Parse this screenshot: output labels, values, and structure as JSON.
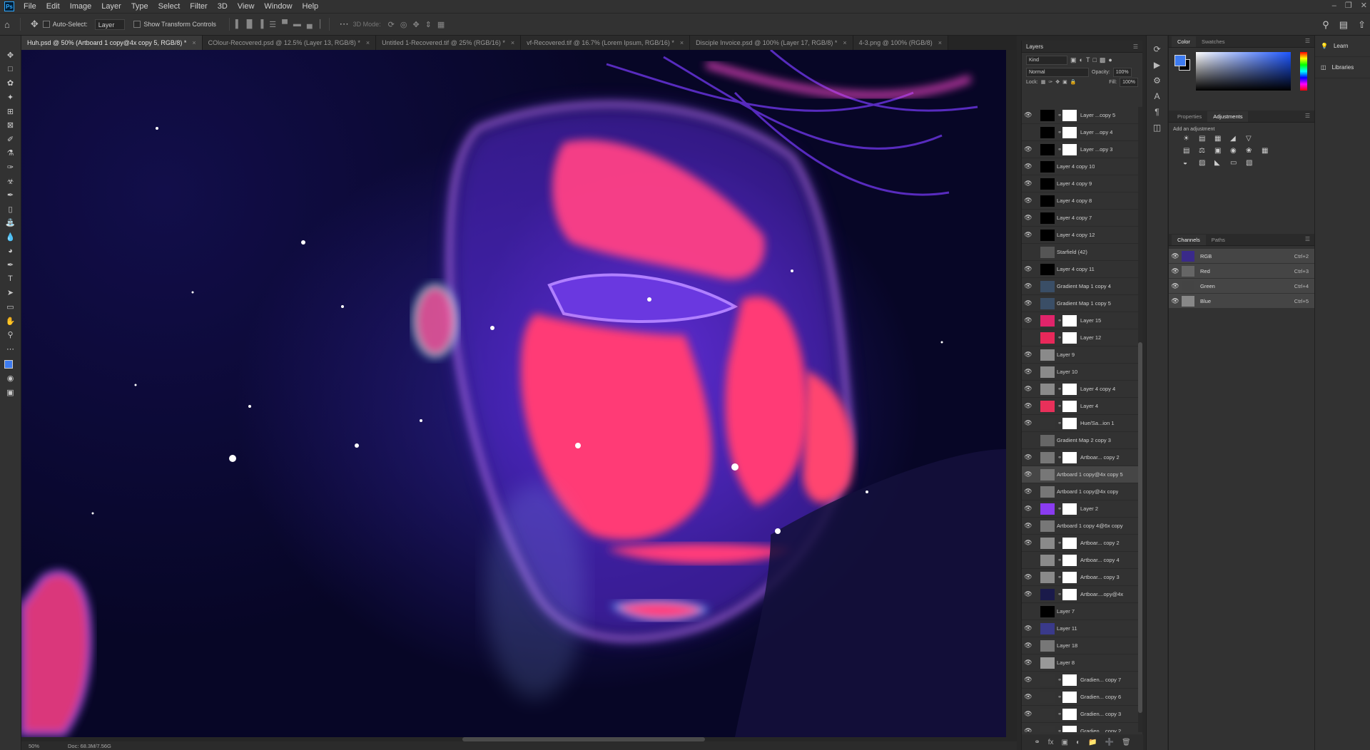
{
  "app": {
    "logo": "Ps"
  },
  "menu": [
    "File",
    "Edit",
    "Image",
    "Layer",
    "Type",
    "Select",
    "Filter",
    "3D",
    "View",
    "Window",
    "Help"
  ],
  "options_bar": {
    "auto_select_label": "Auto-Select:",
    "auto_select_value": "Layer",
    "show_transform_label": "Show Transform Controls",
    "mode_3d_label": "3D Mode:"
  },
  "doc_tabs": [
    "Huh.psd @ 50% (Artboard 1 copy@4x copy 5, RGB/8) *",
    "COlour-Recovered.psd @ 12.5% (Layer 13, RGB/8) *",
    "Untitled 1-Recovered.tif @ 25% (RGB/16) *",
    "vf-Recovered.tif @ 16.7% (Lorem Ipsum, RGB/16) *",
    "Disciple Invoice.psd @ 100% (Layer 17, RGB/8) *",
    "4-3.png @ 100% (RGB/8)"
  ],
  "status": {
    "zoom": "50%",
    "doc": "Doc: 68.3M/7.56G"
  },
  "layers_panel": {
    "title": "Layers",
    "kind": "Kind",
    "blend_mode": "Normal",
    "opacity_label": "Opacity:",
    "opacity_value": "100%",
    "lock_label": "Lock:",
    "fill_label": "Fill:",
    "fill_value": "100%",
    "layers": [
      {
        "name": "Layer ...copy 5",
        "visible": true,
        "thumb": "#000",
        "mask": true
      },
      {
        "name": "Layer ...opy 4",
        "visible": false,
        "thumb": "#000",
        "mask": true
      },
      {
        "name": "Layer ...opy 3",
        "visible": true,
        "thumb": "#000",
        "mask": true
      },
      {
        "name": "Layer 4 copy 10",
        "visible": true,
        "thumb": "#000",
        "mask": false
      },
      {
        "name": "Layer 4 copy 9",
        "visible": true,
        "thumb": "#000",
        "mask": false
      },
      {
        "name": "Layer 4 copy 8",
        "visible": true,
        "thumb": "#000",
        "mask": false
      },
      {
        "name": "Layer 4 copy 7",
        "visible": true,
        "thumb": "#000",
        "mask": false
      },
      {
        "name": "Layer 4 copy 12",
        "visible": true,
        "thumb": "#000",
        "mask": false
      },
      {
        "name": "Starfield (42)",
        "visible": false,
        "thumb": "#555",
        "mask": false
      },
      {
        "name": "Layer 4 copy 11",
        "visible": true,
        "thumb": "#000",
        "mask": false
      },
      {
        "name": "Gradient Map 1 copy 4",
        "visible": true,
        "thumb": "#3a4e66",
        "mask": false
      },
      {
        "name": "Gradient Map 1 copy 5",
        "visible": true,
        "thumb": "#3a4e66",
        "mask": false
      },
      {
        "name": "Layer 15",
        "visible": true,
        "thumb": "#e0246a",
        "mask": true
      },
      {
        "name": "Layer 12",
        "visible": false,
        "thumb": "#e8285a",
        "mask": true
      },
      {
        "name": "Layer 9",
        "visible": true,
        "thumb": "#8a8a8a",
        "mask": false
      },
      {
        "name": "Layer 10",
        "visible": true,
        "thumb": "#8a8a8a",
        "mask": false
      },
      {
        "name": "Layer 4 copy 4",
        "visible": true,
        "thumb": "#8a8a8a",
        "mask": true
      },
      {
        "name": "Layer 4",
        "visible": true,
        "thumb": "#e8305a",
        "mask": true
      },
      {
        "name": "Hue/Sa...ion 1",
        "visible": true,
        "thumb": "#333",
        "mask": true
      },
      {
        "name": "Gradient Map 2 copy 3",
        "visible": false,
        "thumb": "#666",
        "mask": false
      },
      {
        "name": "Artboar... copy 2",
        "visible": true,
        "thumb": "#777",
        "mask": true
      },
      {
        "name": "Artboard 1 copy@4x copy 5",
        "visible": true,
        "thumb": "#777",
        "mask": false,
        "selected": true
      },
      {
        "name": "Artboard 1 copy@4x copy",
        "visible": true,
        "thumb": "#777",
        "mask": false
      },
      {
        "name": "Layer 2",
        "visible": true,
        "thumb": "#8a3cf0",
        "mask": true
      },
      {
        "name": "Artboard 1 copy 4@6x copy",
        "visible": true,
        "thumb": "#777",
        "mask": false
      },
      {
        "name": "Artboar... copy 2",
        "visible": true,
        "thumb": "#8a8a8a",
        "mask": true
      },
      {
        "name": "Artboar... copy 4",
        "visible": false,
        "thumb": "#8a8a8a",
        "mask": true
      },
      {
        "name": "Artboar... copy 3",
        "visible": true,
        "thumb": "#8a8a8a",
        "mask": true
      },
      {
        "name": "Artboar....opy@4x",
        "visible": true,
        "thumb": "#1a1a4a",
        "mask": true
      },
      {
        "name": "Layer 7",
        "visible": false,
        "thumb": "#000",
        "mask": false
      },
      {
        "name": "Layer 11",
        "visible": true,
        "thumb": "#3a3a8a",
        "mask": false
      },
      {
        "name": "Layer 18",
        "visible": true,
        "thumb": "#777",
        "mask": false
      },
      {
        "name": "Layer 8",
        "visible": true,
        "thumb": "#999",
        "mask": false
      },
      {
        "name": "Gradien... copy 7",
        "visible": true,
        "thumb": "#333",
        "mask": true
      },
      {
        "name": "Gradien... copy 6",
        "visible": true,
        "thumb": "#333",
        "mask": true
      },
      {
        "name": "Gradien... copy 3",
        "visible": true,
        "thumb": "#333",
        "mask": true
      },
      {
        "name": "Gradien... copy 2",
        "visible": true,
        "thumb": "#333",
        "mask": true
      }
    ]
  },
  "color_panel": {
    "tabs": [
      "Color",
      "Swatches"
    ],
    "foreground": "#3d7bf0"
  },
  "adjustments_panel": {
    "tabs": [
      "Properties",
      "Adjustments"
    ],
    "hint": "Add an adjustment"
  },
  "channels_panel": {
    "tabs": [
      "Channels",
      "Paths"
    ],
    "channels": [
      {
        "name": "RGB",
        "key": "Ctrl+2"
      },
      {
        "name": "Red",
        "key": "Ctrl+3"
      },
      {
        "name": "Green",
        "key": "Ctrl+4"
      },
      {
        "name": "Blue",
        "key": "Ctrl+5"
      }
    ]
  },
  "learn_panel": {
    "items": [
      "Learn",
      "Libraries"
    ]
  }
}
